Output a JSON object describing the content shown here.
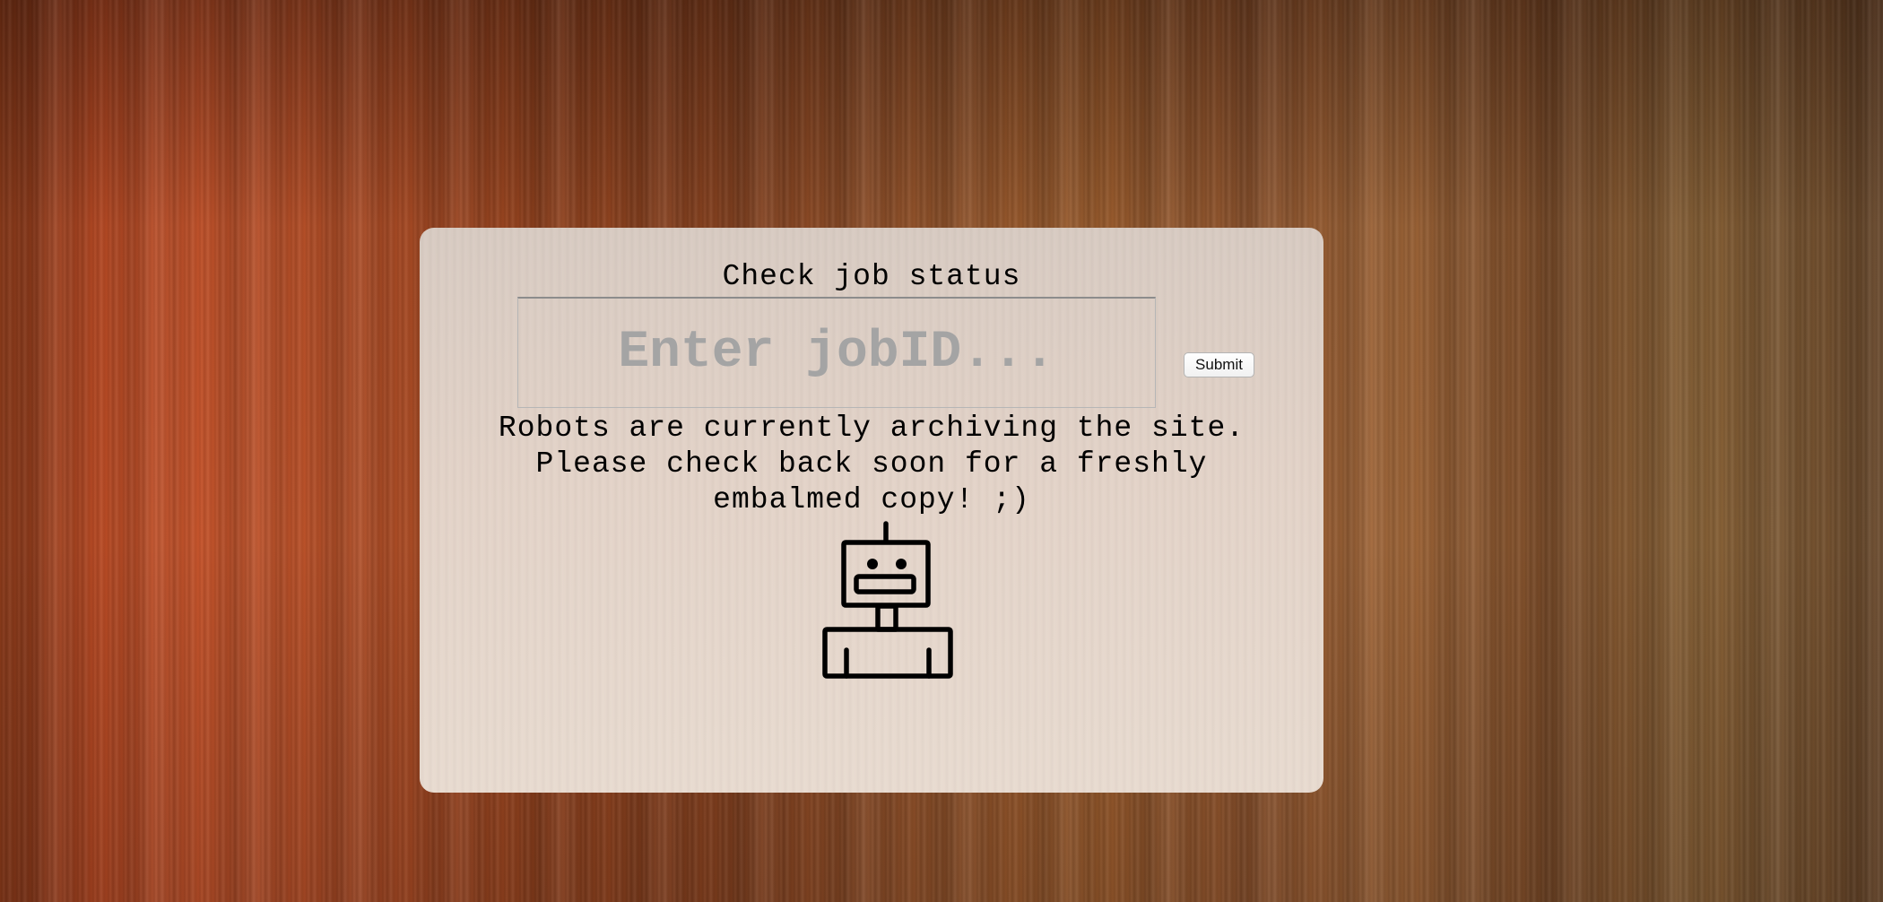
{
  "job_status": {
    "title": "Check job status",
    "input_placeholder": "Enter jobID...",
    "input_value": "",
    "submit_label": "Submit"
  },
  "notice": {
    "line1": "Robots are currently archiving the site.",
    "line2": "Please check back soon for a freshly",
    "line3": "embalmed copy! ;)"
  },
  "icons": {
    "robot": "robot-icon"
  }
}
